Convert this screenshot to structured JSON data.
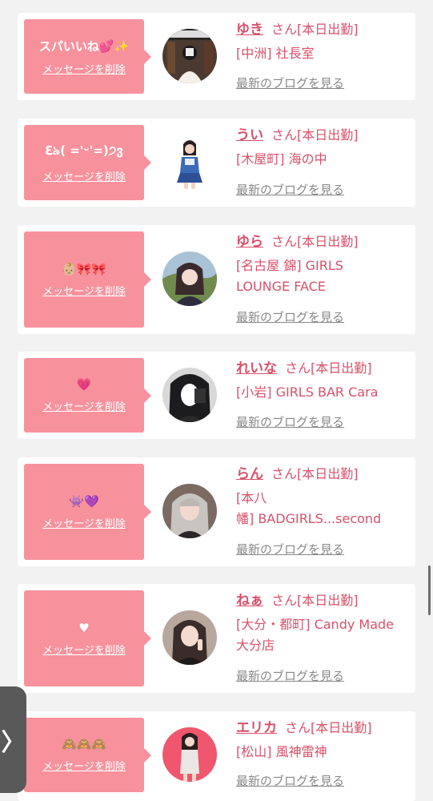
{
  "entries": [
    {
      "message": "スパいいね💕✨",
      "delete_label": "メッセージを削除",
      "name": "ゆき",
      "honorific": "さん",
      "status": "[本日出勤]",
      "shop_line1": "[中洲] 社長室",
      "shop_line2": "",
      "blog_label": "最新のブログを見る",
      "avatar": "avatar-photo-room"
    },
    {
      "message": "ℇ৯( ='ᵕ'=)੭ვ",
      "delete_label": "メッセージを削除",
      "name": "うい",
      "honorific": "さん",
      "status": "[本日出勤]",
      "shop_line1": "[木屋町] 海の中",
      "shop_line2": "",
      "blog_label": "最新のブログを見る",
      "avatar": "avatar-photo-idol"
    },
    {
      "message": "👶🏼🎀🎀",
      "delete_label": "メッセージを削除",
      "name": "ゆら",
      "honorific": "さん",
      "status": "[本日出勤]",
      "shop_line1": "[名古屋 錦] GIRLS",
      "shop_line2": "LOUNGE FACE",
      "blog_label": "最新のブログを見る",
      "avatar": "avatar-photo-outdoor"
    },
    {
      "message": "💗",
      "delete_label": "メッセージを削除",
      "name": "れいな",
      "honorific": "さん",
      "status": "[本日出勤]",
      "shop_line1": "[小岩] GIRLS BAR Cara",
      "shop_line2": "",
      "blog_label": "最新のブログを見る",
      "avatar": "avatar-photo-selfie"
    },
    {
      "message": "👾💜",
      "delete_label": "メッセージを削除",
      "name": "らん",
      "honorific": "さん",
      "status": "[本日出勤]",
      "shop_line1": "[本八",
      "shop_line2": "幡] BADGIRLS...second",
      "blog_label": "最新のブログを見る",
      "avatar": "avatar-photo-ash-hair"
    },
    {
      "message": "♥",
      "delete_label": "メッセージを削除",
      "name": "ねぁ",
      "honorific": "さん",
      "status": "[本日出勤]",
      "shop_line1": "[大分・都町] Candy Made",
      "shop_line2": "大分店",
      "blog_label": "最新のブログを見る",
      "avatar": "avatar-photo-peace"
    },
    {
      "message": "🙈🙈🙈",
      "delete_label": "メッセージを削除",
      "name": "エリカ",
      "honorific": "さん",
      "status": "[本日出勤]",
      "shop_line1": "[松山] 風神雷神",
      "shop_line2": "",
      "blog_label": "最新のブログを見る",
      "avatar": "avatar-photo-pink"
    }
  ],
  "side_tab_glyph": "〉",
  "colors": {
    "accent": "#d9506a",
    "bubble": "#f7929d",
    "link_gray": "#888888",
    "background": "#f2f2f2"
  }
}
